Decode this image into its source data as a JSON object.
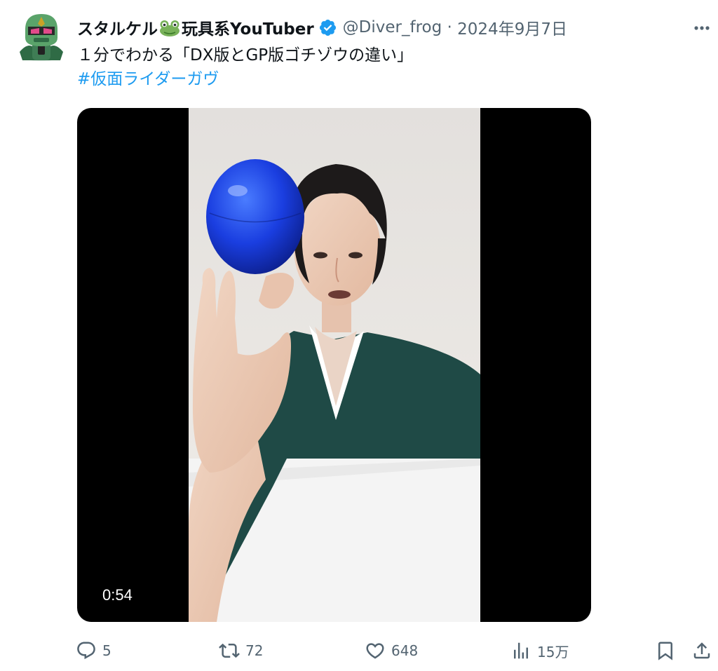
{
  "user": {
    "display_name_prefix": "スタルケル",
    "display_name_suffix": "玩具系YouTuber",
    "emoji_icon": "frog-emoji",
    "handle": "@Diver_frog",
    "separator": " · ",
    "date": "2024年9月7日",
    "verified": true
  },
  "tweet": {
    "text": "１分でわかる「DX版とGP版ゴチゾウの違い」",
    "hashtag": "#仮面ライダーガヴ"
  },
  "video": {
    "duration": "0:54"
  },
  "actions": {
    "replies": "5",
    "reposts": "72",
    "likes": "648",
    "views": "15万"
  },
  "colors": {
    "text": "#0f1419",
    "muted": "#536471",
    "accent": "#1d9bf0"
  }
}
